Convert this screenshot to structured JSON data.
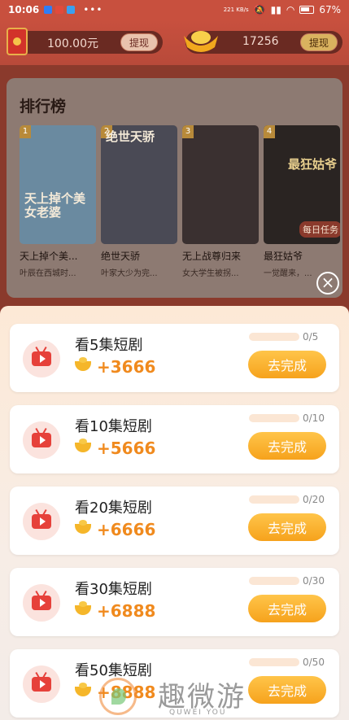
{
  "status_bar": {
    "time": "10:06",
    "network_speed": "221 KB/s",
    "battery": "67%"
  },
  "wallet": {
    "cash_amount": "100.00元",
    "cash_withdraw_label": "提现",
    "gold_amount": "17256",
    "gold_withdraw_label": "提现"
  },
  "ranking": {
    "title": "排行榜",
    "items": [
      {
        "rank": "1",
        "name": "天上掉个美...",
        "desc": "叶辰在西城时...",
        "poster_text": "天上掉个美女老婆",
        "color": "#6a8aa0"
      },
      {
        "rank": "2",
        "name": "绝世天骄",
        "desc": "叶家大少为完...",
        "poster_text": "绝世天骄",
        "color": "#4a4a55"
      },
      {
        "rank": "3",
        "name": "无上战尊归来",
        "desc": "女大学生被拐...",
        "poster_text": "",
        "color": "#3a3030"
      },
      {
        "rank": "4",
        "name": "最狂姑爷",
        "desc": "一觉醒来，...",
        "poster_text": "最狂姑爷",
        "color": "#2a2422"
      }
    ],
    "daily_task_tag": "每日任务"
  },
  "tasks": [
    {
      "title": "看5集短剧",
      "reward": "+3666",
      "progress": "0/5",
      "fill": 0,
      "button": "去完成"
    },
    {
      "title": "看10集短剧",
      "reward": "+5666",
      "progress": "0/10",
      "fill": 0,
      "button": "去完成"
    },
    {
      "title": "看20集短剧",
      "reward": "+6666",
      "progress": "0/20",
      "fill": 0,
      "button": "去完成"
    },
    {
      "title": "看30集短剧",
      "reward": "+6888",
      "progress": "0/30",
      "fill": 0,
      "button": "去完成"
    },
    {
      "title": "看50集短剧",
      "reward": "+8888",
      "progress": "0/50",
      "fill": 0,
      "button": "去完成"
    }
  ],
  "watermark": {
    "text": "趣微游",
    "sub": "QUWEI YOU"
  },
  "colors": {
    "accent": "#f5a623",
    "reward": "#f08a1e",
    "header": "#c8503e"
  }
}
